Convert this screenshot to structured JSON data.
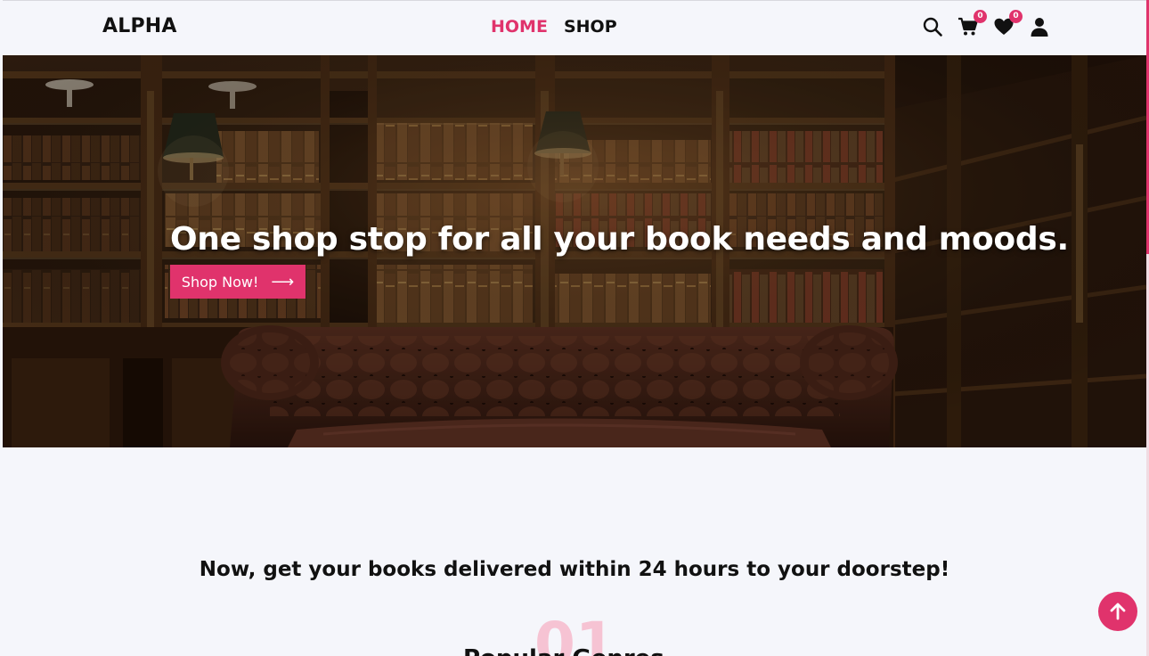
{
  "brand": {
    "name": "ALPHA"
  },
  "nav": {
    "links": [
      {
        "label": "HOME",
        "active": true
      },
      {
        "label": "SHOP",
        "active": false
      }
    ]
  },
  "icons": {
    "search": "search-icon",
    "cart": "cart-icon",
    "wishlist": "heart-icon",
    "account": "user-icon",
    "cart_count": "0",
    "wishlist_count": "0"
  },
  "hero": {
    "title": "One shop stop for all your book needs and moods.",
    "cta_label": "Shop Now!",
    "cta_arrow": "⟶"
  },
  "delivery": {
    "text": "Now, get your books delivered within 24 hours to your doorstep!"
  },
  "section": {
    "number": "01",
    "heading": "Popular Genres"
  },
  "colors": {
    "accent": "#e0336c",
    "background": "#f5f6fb",
    "text": "#111111"
  }
}
